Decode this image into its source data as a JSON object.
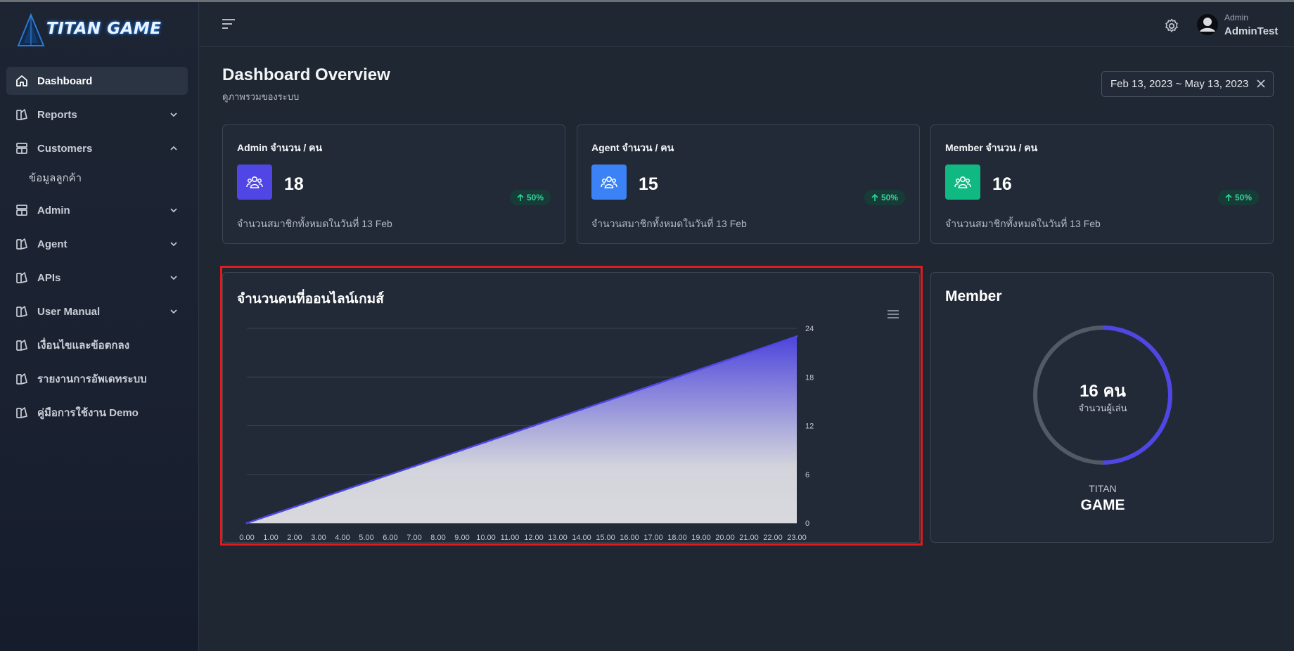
{
  "brand": {
    "logo_text": "TITAN GAME"
  },
  "sidebar": {
    "items": [
      {
        "label": "Dashboard",
        "icon": "home-icon",
        "active": true,
        "chevron": ""
      },
      {
        "label": "Reports",
        "icon": "reports-icon",
        "chevron": "down"
      },
      {
        "label": "Customers",
        "icon": "customers-icon",
        "chevron": "up"
      },
      {
        "label": "Admin",
        "icon": "admin-icon",
        "chevron": "down"
      },
      {
        "label": "Agent",
        "icon": "agent-icon",
        "chevron": "down"
      },
      {
        "label": "APIs",
        "icon": "apis-icon",
        "chevron": "down"
      },
      {
        "label": "User Manual",
        "icon": "manual-icon",
        "chevron": "down"
      },
      {
        "label": "เงื่อนไขและข้อตกลง",
        "icon": "terms-icon",
        "chevron": ""
      },
      {
        "label": "รายงานการอัพเดทระบบ",
        "icon": "update-report-icon",
        "chevron": ""
      },
      {
        "label": "คู่มือการใช้งาน Demo",
        "icon": "demo-manual-icon",
        "chevron": ""
      }
    ],
    "customers_sub": "ข้อมูลลูกค้า"
  },
  "header": {
    "user_role": "Admin",
    "user_name": "AdminTest"
  },
  "main": {
    "title": "Dashboard Overview",
    "subtitle": "ดูภาพรวมของระบบ",
    "date_range": "Feb 13, 2023 ~ May 13, 2023"
  },
  "cards": [
    {
      "title": "Admin จำนวน / คน",
      "value": "18",
      "badge": "50%",
      "desc": "จำนวนสมาชิกทั้งหมดในวันที่ 13 Feb",
      "color": "#4f46e5"
    },
    {
      "title": "Agent จำนวน / คน",
      "value": "15",
      "badge": "50%",
      "desc": "จำนวนสมาชิกทั้งหมดในวันที่ 13 Feb",
      "color": "#3b82f6"
    },
    {
      "title": "Member จำนวน / คน",
      "value": "16",
      "badge": "50%",
      "desc": "จำนวนสมาชิกทั้งหมดในวันที่ 13 Feb",
      "color": "#10b981"
    }
  ],
  "member": {
    "title": "Member",
    "value": "16 คน",
    "label": "จำนวนผู้เล่น",
    "brand_top": "TITAN",
    "brand_bottom": "GAME",
    "fill_fraction": 0.5
  },
  "chart_data": {
    "type": "area",
    "title": "จำนวนคนที่ออนไลน์เกมส์",
    "x": [
      "0.00",
      "1.00",
      "2.00",
      "3.00",
      "4.00",
      "5.00",
      "6.00",
      "7.00",
      "8.00",
      "9.00",
      "10.00",
      "11.00",
      "12.00",
      "13.00",
      "14.00",
      "15.00",
      "16.00",
      "17.00",
      "18.00",
      "19.00",
      "20.00",
      "21.00",
      "22.00",
      "23.00"
    ],
    "values": [
      0,
      1,
      2,
      3,
      4,
      5,
      6,
      7,
      8,
      9,
      10,
      11,
      12,
      13,
      14,
      15,
      16,
      17,
      18,
      19,
      20,
      21,
      22,
      23
    ],
    "ylim": [
      0,
      24
    ],
    "yticks": [
      0,
      6,
      12,
      18,
      24
    ],
    "grid": true,
    "y_axis_side": "right",
    "color": "#4f46e5"
  }
}
